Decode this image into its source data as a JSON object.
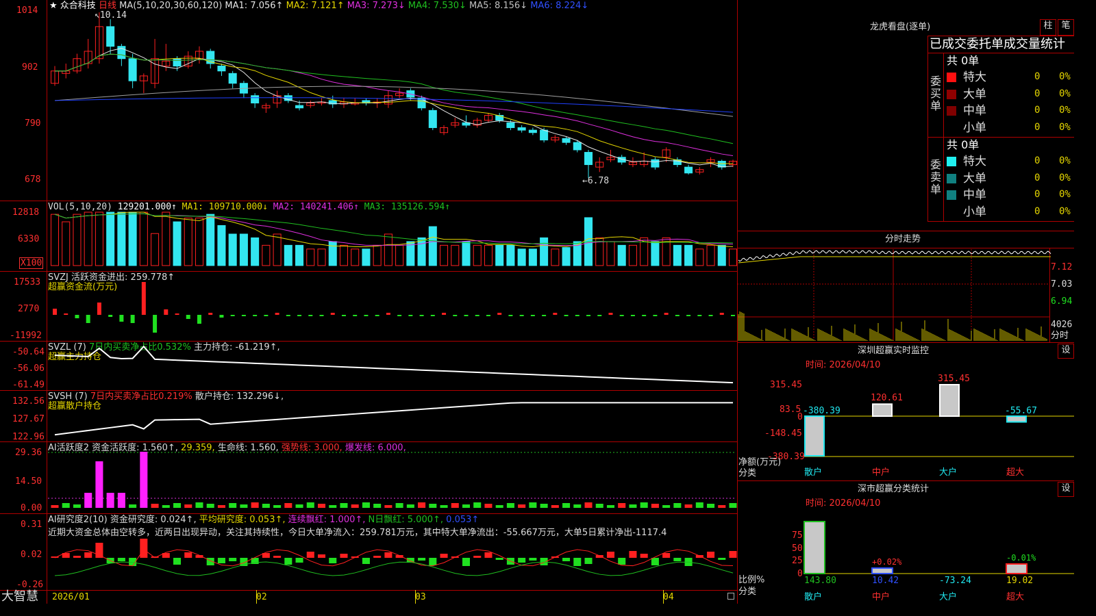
{
  "colors": {
    "up": "#ff2020",
    "down": "#33e6f0",
    "ma1": "#e6e6e6",
    "ma2": "#e6d700",
    "ma3": "#e030e0",
    "ma4": "#20c020",
    "ma5": "#a0a0a0",
    "ma6": "#2040ff",
    "grid": "#b00000",
    "buy": "#ff2020",
    "sell": "#20e020"
  },
  "header": {
    "star": "★",
    "stock": "众合科技",
    "period": "日线",
    "ma_label": "MA(5,10,20,30,60,120)",
    "ma": [
      {
        "k": "MA1:",
        "v": "7.056↑"
      },
      {
        "k": "MA2:",
        "v": "7.121↑"
      },
      {
        "k": "MA3:",
        "v": "7.273↓"
      },
      {
        "k": "MA4:",
        "v": "7.530↓"
      },
      {
        "k": "MA5:",
        "v": "8.156↓"
      },
      {
        "k": "MA6:",
        "v": "8.224↓"
      }
    ]
  },
  "price_axis": [
    "1014",
    "902",
    "790",
    "678"
  ],
  "price_annot": {
    "high": "10.14",
    "low": "6.78"
  },
  "vol": {
    "header": "VOL(5,10,20)",
    "val": "129201.000↑",
    "ma1": "MA1: 109710.000↓",
    "ma2": "MA2: 140241.406↑",
    "ma3": "MA3: 135126.594↑",
    "axis": [
      "12818",
      "6330"
    ],
    "unit": "X100"
  },
  "svzj": {
    "header": "SVZJ",
    "label": "活跃资金进出: 259.778↑",
    "sub": "超赢资金流(万元)",
    "axis": [
      "17533",
      "2770",
      "-11992"
    ]
  },
  "svzl": {
    "header": "SVZL (7)",
    "pct": "7日内买卖净占比0.532%",
    "label": "主力持仓: -61.219↑,",
    "sub": "超赢主力持仓",
    "axis": [
      "-50.64",
      "-56.06",
      "-61.49"
    ]
  },
  "svsh": {
    "header": "SVSH (7)",
    "pct": "7日内买卖净占比0.219%",
    "label": "散户持仓: 132.296↓,",
    "sub": "超赢散户持仓",
    "axis": [
      "132.56",
      "127.67",
      "122.96"
    ]
  },
  "ai1": {
    "header": "AI活跃度2",
    "a": "资金活跃度: 1.560↑,",
    "b": "29.359,",
    "c": "生命线: 1.560,",
    "d": "强势线: 3.000,",
    "e": "爆发线: 6.000,",
    "axis": [
      "29.36",
      "14.50",
      "0.00"
    ]
  },
  "ai2": {
    "header": "AI研究度2(10)",
    "a": "资金研究度: 0.024↑,",
    "b": "平均研究度: 0.053↑,",
    "c": "连续飘红: 1.000↑,",
    "d": "N日飘红: 5.000↑,",
    "e": "0.053↑",
    "comment": "近期大资金总体由空转多，近两日出现异动，关注其持续性，今日大单净流入：259.781万元，其中特大单净流出：-55.667万元，大单5日累计净出-1117.4",
    "axis": [
      "0.31",
      "0.02",
      "-0.26"
    ]
  },
  "dates": [
    "2026/01",
    "02",
    "03",
    "04"
  ],
  "brand": "大智慧",
  "right": {
    "title": "龙虎看盘(逐单)",
    "tab1": "柱",
    "tab2": "笔",
    "stat_title": "已成交委托单成交量统计",
    "buy": {
      "side": "委买单",
      "total": "共 0单",
      "rows": [
        {
          "n": "特大",
          "v": "0",
          "p": "0%"
        },
        {
          "n": "大单",
          "v": "0",
          "p": "0%"
        },
        {
          "n": "中单",
          "v": "0",
          "p": "0%"
        },
        {
          "n": "小单",
          "v": "0",
          "p": "0%"
        }
      ]
    },
    "sell": {
      "side": "委卖单",
      "total": "共 0单",
      "rows": [
        {
          "n": "特大",
          "v": "0",
          "p": "0%"
        },
        {
          "n": "大单",
          "v": "0",
          "p": "0%"
        },
        {
          "n": "中单",
          "v": "0",
          "p": "0%"
        },
        {
          "n": "小单",
          "v": "0",
          "p": "0%"
        }
      ]
    },
    "intraday": {
      "title": "分时走势",
      "axis": [
        "7.12",
        "7.03",
        "6.94"
      ],
      "vol": "4026",
      "vol_unit": "分时"
    },
    "monitor": {
      "title": "深圳超赢实时监控",
      "btn": "设",
      "time": "时间: 2026/04/10",
      "axis": [
        "315.45",
        "83.5",
        "0",
        "-148.45",
        "-380.39"
      ],
      "ylabel": "净额(万元)",
      "xlabel": "分类",
      "bars": [
        {
          "cat": "散户",
          "v": "-380.39"
        },
        {
          "cat": "中户",
          "v": "120.61"
        },
        {
          "cat": "大户",
          "v": "315.45"
        },
        {
          "cat": "超大",
          "v": "-55.67"
        }
      ]
    },
    "classify": {
      "title": "深市超赢分类统计",
      "btn": "设",
      "time": "时间: 2026/04/10",
      "axis": [
        "75",
        "50",
        "25",
        "0"
      ],
      "ylabel": "比例%",
      "xlabel": "分类",
      "bars": [
        {
          "cat": "散户",
          "v": "143.80",
          "pct": ""
        },
        {
          "cat": "中户",
          "v": "10.42",
          "pct": "+0.02%"
        },
        {
          "cat": "大户",
          "v": "-73.24",
          "pct": ""
        },
        {
          "cat": "超大",
          "v": "19.02",
          "pct": "-0.01%"
        }
      ]
    }
  },
  "chart_data": {
    "type": "candlestick",
    "ylim": [
      6.78,
      10.14
    ],
    "candles": [
      [
        8.7,
        8.95,
        9.05,
        8.65
      ],
      [
        8.9,
        8.95,
        9.1,
        8.8
      ],
      [
        8.95,
        9.2,
        9.3,
        8.9
      ],
      [
        9.1,
        9.35,
        9.6,
        9.0
      ],
      [
        9.2,
        9.85,
        10.14,
        9.1
      ],
      [
        9.85,
        9.45,
        10.0,
        9.3
      ],
      [
        9.45,
        9.2,
        9.5,
        9.05
      ],
      [
        9.2,
        8.75,
        9.3,
        8.6
      ],
      [
        8.75,
        8.85,
        8.9,
        8.5
      ],
      [
        8.7,
        9.2,
        9.6,
        8.6
      ],
      [
        9.05,
        9.15,
        9.5,
        8.95
      ],
      [
        9.2,
        9.05,
        9.25,
        8.95
      ],
      [
        9.05,
        9.25,
        9.35,
        9.0
      ],
      [
        9.2,
        9.35,
        9.45,
        9.1
      ],
      [
        9.35,
        9.1,
        9.4,
        9.0
      ],
      [
        9.05,
        8.95,
        9.1,
        8.85
      ],
      [
        8.9,
        8.7,
        8.95,
        8.6
      ],
      [
        8.7,
        8.5,
        8.75,
        8.4
      ],
      [
        8.45,
        8.3,
        8.5,
        8.2
      ],
      [
        8.2,
        8.25,
        8.3,
        8.1
      ],
      [
        8.3,
        8.45,
        8.55,
        8.2
      ],
      [
        8.45,
        8.35,
        8.5,
        8.3
      ],
      [
        8.25,
        8.2,
        8.35,
        8.15
      ],
      [
        8.25,
        8.3,
        8.35,
        8.2
      ],
      [
        8.3,
        8.32,
        8.4,
        8.25
      ],
      [
        8.35,
        8.28,
        8.45,
        8.2
      ],
      [
        8.28,
        8.32,
        8.4,
        8.2
      ],
      [
        8.3,
        8.3,
        8.4,
        8.25
      ],
      [
        8.35,
        8.3,
        8.4,
        8.25
      ],
      [
        8.3,
        8.32,
        8.4,
        8.2
      ],
      [
        8.28,
        8.45,
        8.55,
        8.2
      ],
      [
        8.45,
        8.5,
        8.6,
        8.4
      ],
      [
        8.55,
        8.42,
        8.6,
        8.35
      ],
      [
        8.4,
        8.2,
        8.45,
        8.15
      ],
      [
        8.15,
        7.8,
        8.2,
        7.75
      ],
      [
        7.7,
        7.8,
        7.85,
        7.65
      ],
      [
        7.85,
        7.9,
        8.0,
        7.8
      ],
      [
        7.9,
        7.85,
        8.05,
        7.8
      ],
      [
        7.85,
        7.95,
        8.0,
        7.8
      ],
      [
        7.95,
        8.05,
        8.1,
        7.9
      ],
      [
        8.05,
        7.95,
        8.1,
        7.9
      ],
      [
        7.9,
        7.8,
        7.95,
        7.75
      ],
      [
        7.8,
        7.75,
        7.85,
        7.7
      ],
      [
        7.75,
        7.7,
        7.8,
        7.65
      ],
      [
        7.75,
        7.55,
        7.8,
        7.5
      ],
      [
        7.55,
        7.6,
        7.65,
        7.5
      ],
      [
        7.58,
        7.5,
        7.62,
        7.45
      ],
      [
        7.5,
        7.35,
        7.55,
        7.3
      ],
      [
        7.3,
        7.05,
        7.35,
        6.78
      ],
      [
        7.0,
        7.1,
        7.2,
        6.9
      ],
      [
        7.15,
        7.2,
        7.35,
        7.1
      ],
      [
        7.2,
        7.1,
        7.25,
        7.05
      ],
      [
        7.05,
        7.1,
        7.2,
        7.0
      ],
      [
        7.05,
        7.12,
        7.3,
        7.0
      ],
      [
        7.15,
        7.0,
        7.2,
        6.95
      ],
      [
        7.2,
        7.35,
        7.4,
        7.1
      ],
      [
        7.15,
        7.05,
        7.2,
        7.0
      ],
      [
        7.0,
        6.88,
        7.05,
        6.85
      ],
      [
        6.9,
        6.95,
        7.0,
        6.85
      ],
      [
        7.1,
        7.15,
        7.2,
        7.0
      ],
      [
        7.12,
        7.0,
        7.15,
        6.95
      ],
      [
        7.05,
        7.12,
        7.15,
        7.0
      ]
    ]
  }
}
